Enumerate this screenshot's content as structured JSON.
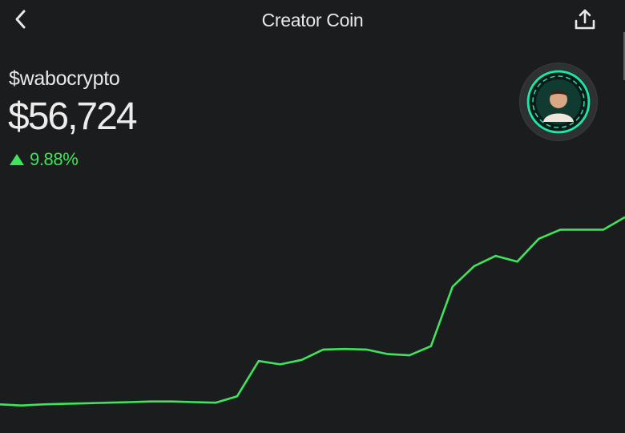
{
  "header": {
    "title": "Creator Coin",
    "back_icon": "chevron-left-icon",
    "share_icon": "share-upload-icon"
  },
  "coin": {
    "ticker": "$wabocrypto",
    "price": "$56,724",
    "change": "9.88%",
    "change_direction": "up",
    "change_color": "#3ee45b"
  },
  "avatar": {
    "ring_color": "#1fe3a8"
  },
  "chart_data": {
    "type": "line",
    "title": "",
    "xlabel": "",
    "ylabel": "",
    "color": "#3ee45b",
    "grid": false,
    "ylim": [
      0,
      100
    ],
    "series": [
      {
        "values": [
          4,
          3,
          4,
          4.5,
          5,
          5.5,
          6,
          6.5,
          6.5,
          6,
          5.5,
          11,
          42,
          39,
          43,
          52,
          52.5,
          52,
          48,
          47,
          55,
          107,
          125,
          134,
          129,
          149,
          157,
          157,
          157,
          168
        ]
      }
    ]
  }
}
